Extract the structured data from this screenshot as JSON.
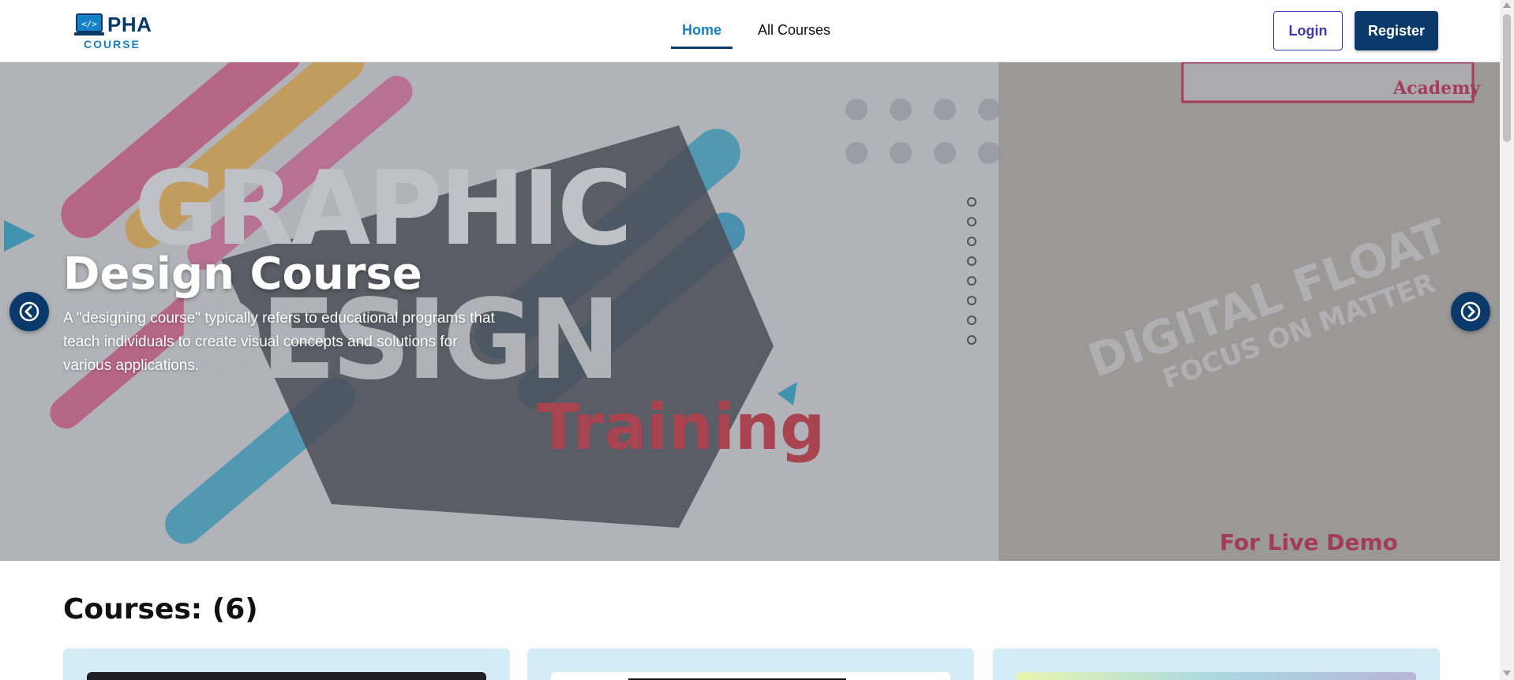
{
  "header": {
    "logo_text": "PHA",
    "logo_sub": "COURSE",
    "nav": [
      {
        "label": "Home",
        "active": true
      },
      {
        "label": "All Courses",
        "active": false
      }
    ],
    "login_label": "Login",
    "register_label": "Register"
  },
  "hero": {
    "title": "Design Course",
    "description": "A \"designing course\" typically refers to educational programs that teach individuals to create visual concepts and solutions for various applications.",
    "background_text": {
      "graphic": "GRAPHIC",
      "design": "DESIGN",
      "training": "Training",
      "digital_floats": "DIGITAL FLOAT",
      "focus": "FOCUS ON MATTER",
      "live_demo": "For Live Demo",
      "academy": "Academy"
    }
  },
  "courses": {
    "heading": "Courses: (6)"
  },
  "colors": {
    "brand_dark": "#0b3a6a",
    "brand_light": "#1581c6",
    "card_bg": "#d3ecf6"
  }
}
